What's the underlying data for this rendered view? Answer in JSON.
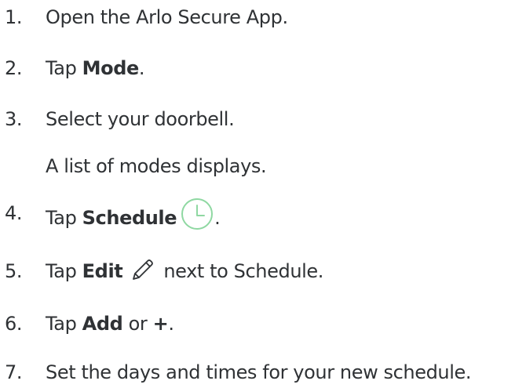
{
  "steps": [
    {
      "number": "1.",
      "text": "Open the Arlo Secure App."
    },
    {
      "number": "2.",
      "pre": "Tap ",
      "bold": "Mode",
      "post": "."
    },
    {
      "number": "3.",
      "text": "Select your doorbell."
    },
    {
      "note": "A list of modes displays."
    },
    {
      "number": "4.",
      "pre": "Tap ",
      "bold": "Schedule",
      "icon": "clock-icon",
      "post": "."
    },
    {
      "number": "5.",
      "pre": "Tap ",
      "bold": "Edit",
      "icon": "pencil-icon",
      "post": "next to Schedule."
    },
    {
      "number": "6.",
      "pre": "Tap ",
      "bold": "Add",
      "mid": " or ",
      "bold2": "+",
      "post": "."
    },
    {
      "number": "7.",
      "text": "Set the days and times for your new schedule."
    }
  ],
  "colors": {
    "text": "#2f3235",
    "clock_icon": "#8fd8a2",
    "pencil_icon": "#2f3235"
  }
}
